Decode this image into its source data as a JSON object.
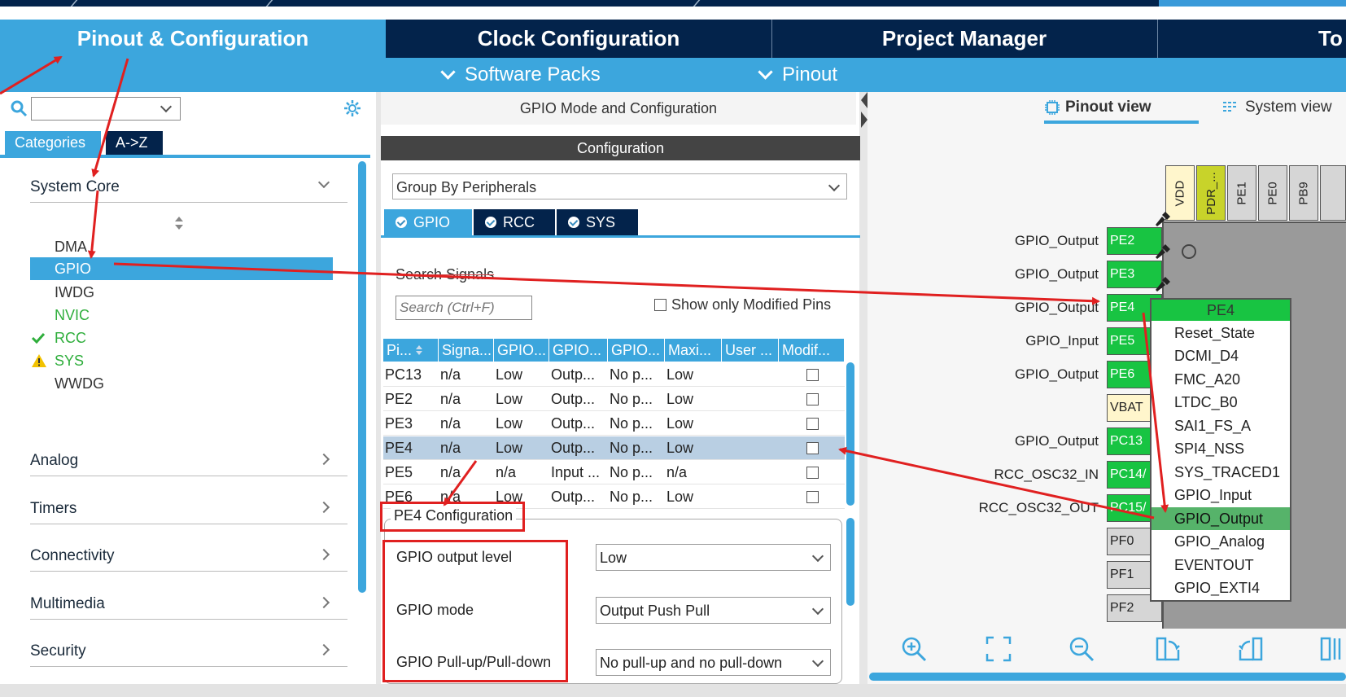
{
  "tabs": {
    "pinout": "Pinout & Configuration",
    "clock": "Clock Configuration",
    "project": "Project Manager",
    "tools": "To"
  },
  "subbar": {
    "software_packs": "Software Packs",
    "pinout": "Pinout"
  },
  "sidebar": {
    "tab_categories": "Categories",
    "tab_az": "A->Z",
    "system_core": "System Core",
    "core_items": {
      "dma": "DMA",
      "gpio": "GPIO",
      "iwdg": "IWDG",
      "nvic": "NVIC",
      "rcc": "RCC",
      "sys": "SYS",
      "wwdg": "WWDG"
    },
    "sections": {
      "analog": "Analog",
      "timers": "Timers",
      "connectivity": "Connectivity",
      "multimedia": "Multimedia",
      "security": "Security"
    },
    "colors": {
      "nvic": "#2fae3c",
      "rcc": "#2fae3c",
      "sys": "#2fae3c"
    }
  },
  "middle": {
    "title": "GPIO Mode and Configuration",
    "config_bar": "Configuration",
    "group_by": "Group By Peripherals",
    "periph_tabs": {
      "gpio": "GPIO",
      "rcc": "RCC",
      "sys": "SYS"
    },
    "search_label": "Search Signals",
    "search_placeholder": "Search (Ctrl+F)",
    "show_modified": "Show only Modified Pins",
    "table": {
      "headers": [
        "Pi...",
        "Signa...",
        "GPIO...",
        "GPIO...",
        "GPIO...",
        "Maxi...",
        "User ...",
        "Modif..."
      ],
      "rows": [
        [
          "PC13",
          "n/a",
          "Low",
          "Outp...",
          "No p...",
          "Low",
          ""
        ],
        [
          "PE2",
          "n/a",
          "Low",
          "Outp...",
          "No p...",
          "Low",
          ""
        ],
        [
          "PE3",
          "n/a",
          "Low",
          "Outp...",
          "No p...",
          "Low",
          ""
        ],
        [
          "PE4",
          "n/a",
          "Low",
          "Outp...",
          "No p...",
          "Low",
          ""
        ],
        [
          "PE5",
          "n/a",
          "n/a",
          "Input ...",
          "No p...",
          "n/a",
          ""
        ],
        [
          "PE6",
          "n/a",
          "Low",
          "Outp...",
          "No p...",
          "Low",
          ""
        ]
      ]
    },
    "pe4_config": {
      "title": "PE4 Configuration",
      "output_level_label": "GPIO output level",
      "output_level_value": "Low",
      "mode_label": "GPIO mode",
      "mode_value": "Output Push Pull",
      "pull_label": "GPIO Pull-up/Pull-down",
      "pull_value": "No pull-up and no pull-down"
    }
  },
  "right": {
    "pinout_view": "Pinout view",
    "system_view": "System view",
    "top_pins": [
      "VDD",
      "PDR_...",
      "PE1",
      "PE0",
      "PB9"
    ],
    "left_pins": [
      {
        "pin": "PE2",
        "signal": "GPIO_Output"
      },
      {
        "pin": "PE3",
        "signal": "GPIO_Output"
      },
      {
        "pin": "PE4",
        "signal": "GPIO_Output"
      },
      {
        "pin": "PE5",
        "signal": "GPIO_Input"
      },
      {
        "pin": "PE6",
        "signal": "GPIO_Output"
      },
      {
        "pin": "VBAT",
        "signal": ""
      },
      {
        "pin": "PC13",
        "signal": "GPIO_Output"
      },
      {
        "pin": "PC14/",
        "signal": "RCC_OSC32_IN"
      },
      {
        "pin": "PC15/",
        "signal": "RCC_OSC32_OUT"
      },
      {
        "pin": "PF0",
        "signal": ""
      },
      {
        "pin": "PF1",
        "signal": ""
      },
      {
        "pin": "PF2",
        "signal": ""
      }
    ],
    "context_menu": {
      "header": "PE4",
      "items": [
        "Reset_State",
        "DCMI_D4",
        "FMC_A20",
        "LTDC_B0",
        "SAI1_FS_A",
        "SPI4_NSS",
        "SYS_TRACED1",
        "GPIO_Input",
        "GPIO_Output",
        "GPIO_Analog",
        "EVENTOUT",
        "GPIO_EXTI4"
      ],
      "selected": "GPIO_Output"
    }
  },
  "annotation_color": "#e02020",
  "accent_color": "#3ca6dd",
  "dark_color": "#03234b",
  "pin_green": "#18c442"
}
